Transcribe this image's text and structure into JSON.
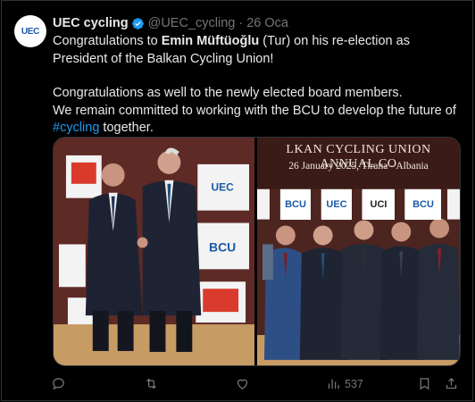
{
  "account": {
    "name": "UEC cycling",
    "handle": "@UEC_cycling",
    "separator": "·",
    "date": "26 Oca",
    "avatar_text": "UEC",
    "verified": true
  },
  "tweet": {
    "line1_pre": "Congratulations to ",
    "line1_bold": "Emin Müftüoğlu",
    "line1_post": " (Tur) on his re-election as President of the Balkan Cycling Union!",
    "line2": "Congratulations as well to the newly elected board members.",
    "line3_pre": "We remain committed to working with the BCU to develop the future of ",
    "hashtag": "#cycling",
    "line3_post": " together."
  },
  "media": {
    "left_panels": [
      "UEC",
      "BCU"
    ],
    "right_banner": "LKAN CYCLING UNION ANNUAL CO",
    "right_banner_sub": "26 January 2025, Tirana - Albania",
    "right_panels": [
      "BCU",
      "UEC",
      "UCI",
      "BCU"
    ]
  },
  "actions": {
    "views": "537"
  },
  "colors": {
    "accent": "#1d9bf0",
    "muted": "#71767b",
    "text": "#e7e9ea"
  }
}
